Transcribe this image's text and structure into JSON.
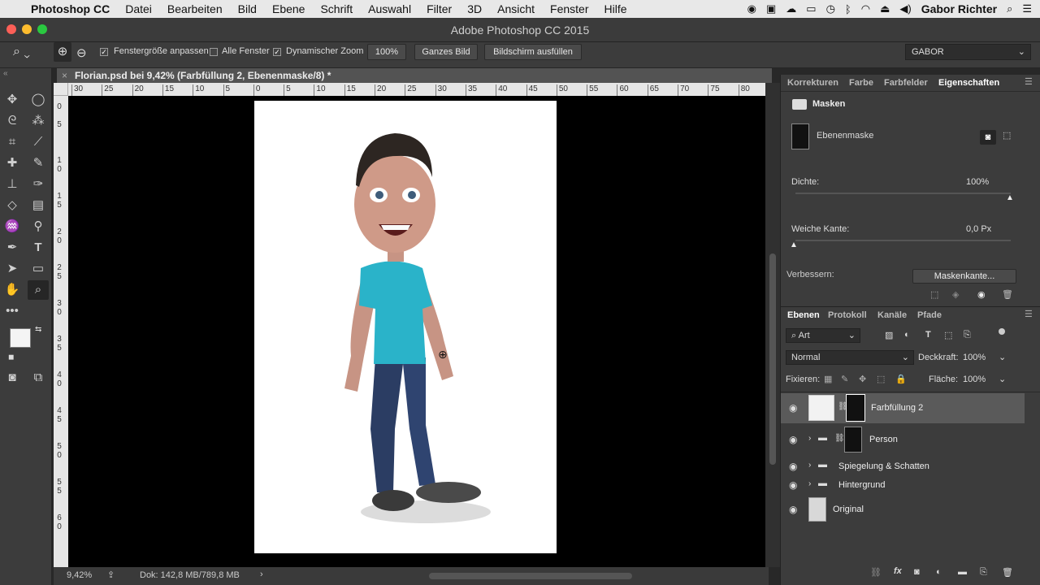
{
  "menubar": {
    "app_name": "Photoshop CC",
    "items": [
      "Datei",
      "Bearbeiten",
      "Bild",
      "Ebene",
      "Schrift",
      "Auswahl",
      "Filter",
      "3D",
      "Ansicht",
      "Fenster",
      "Hilfe"
    ],
    "user": "Gabor Richter"
  },
  "window": {
    "title": "Adobe Photoshop CC 2015"
  },
  "options": {
    "fit_window_label": "Fenstergröße anpassen",
    "all_windows_label": "Alle Fenster",
    "scrubby_zoom_label": "Dynamischer Zoom",
    "zoom_100_label": "100%",
    "fit_screen_label": "Ganzes Bild",
    "fill_screen_label": "Bildschirm ausfüllen",
    "workspace": "GABOR"
  },
  "document": {
    "tab_title": "Florian.psd bei 9,42% (Farbfüllung 2, Ebenenmaske/8) *",
    "ruler_top_ticks": [
      "30",
      "25",
      "20",
      "15",
      "10",
      "5",
      "0",
      "5",
      "10",
      "15",
      "20",
      "25",
      "30",
      "35",
      "40",
      "45",
      "50",
      "55",
      "60",
      "65",
      "70",
      "75",
      "80"
    ],
    "zoom": "9,42%",
    "doc_info": "Dok: 142,8 MB/789,8 MB"
  },
  "properties": {
    "tabs": [
      "Korrekturen",
      "Farbe",
      "Farbfelder",
      "Eigenschaften"
    ],
    "section_title": "Masken",
    "mask_label": "Ebenenmaske",
    "density_label": "Dichte:",
    "density_value": "100%",
    "density_level": 1.0,
    "feather_label": "Weiche Kante:",
    "feather_value": "0,0 Px",
    "feather_level": 0.0,
    "refine_label": "Verbessern:",
    "mask_edge_button": "Maskenkante..."
  },
  "layers_panel": {
    "tabs": [
      "Ebenen",
      "Protokoll",
      "Kanäle",
      "Pfade"
    ],
    "filter_kind": "Art",
    "blend_mode": "Normal",
    "opacity_label": "Deckkraft:",
    "opacity_value": "100%",
    "lock_label": "Fixieren:",
    "fill_label": "Fläche:",
    "fill_value": "100%",
    "layers": [
      {
        "name": "Farbfüllung 2"
      },
      {
        "name": "Person"
      },
      {
        "name": "Spiegelung & Schatten"
      },
      {
        "name": "Hintergrund"
      },
      {
        "name": "Original"
      }
    ]
  },
  "colors": {
    "accent_teal": "#2ab3c9",
    "panel_bg": "#3c3c3c",
    "canvas_bg": "#000000"
  }
}
